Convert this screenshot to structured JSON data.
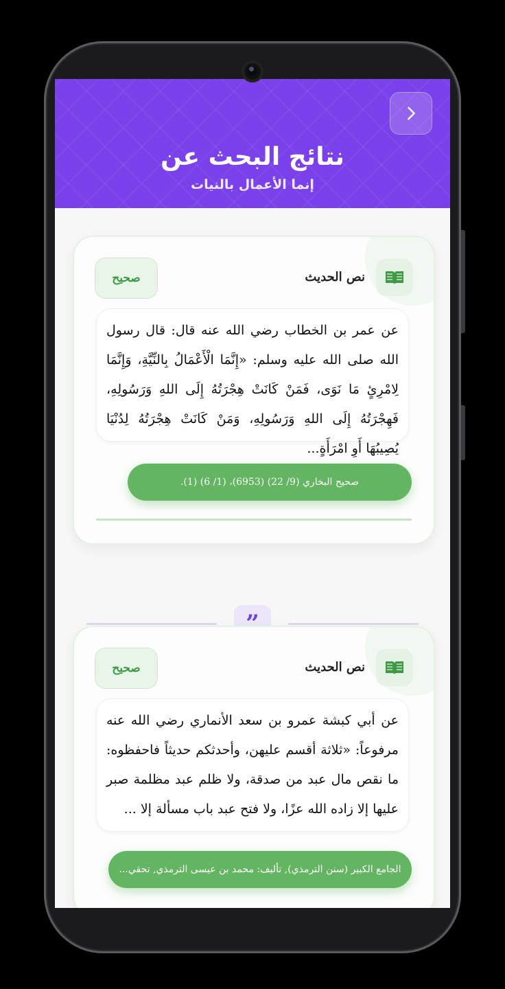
{
  "header": {
    "title": "نتائج البحث عن",
    "subtitle": "إنما الأعمال بالنيات",
    "back_icon": "chevron-right-icon",
    "bg_color": "#7a41ea"
  },
  "results": [
    {
      "label": "نص الحديث",
      "grade": "صحيح",
      "text": "عن عمر بن الخطاب رضي الله عنه قال: قال رسول الله صلى الله عليه وسلم: «إِنَّمَا الْأَعْمَالُ بِالنِّيَّةِ، وَإِنَّمَا لِامْرِئٍ مَا نَوَى، فَمَنْ كَانَتْ هِجْرَتُهُ إِلَى اللهِ وَرَسُولِهِ، فَهِجْرَتُهُ إِلَى اللهِ وَرَسُولِهِ، وَمَنْ كَانَتْ هِجْرَتُهُ لِدُنْيَا يُصِيبُهَا أَوِ امْرَأَةٍ...",
      "source": "صحيح البخاري (9/ 22) (6953)، (1/ 6) (1)."
    },
    {
      "label": "نص الحديث",
      "grade": "صحيح",
      "text": "عن أبي كبشة عمرو بن سعد الأنماري رضي الله عنه مرفوعاً: «ثلاثة أقسم عليهن، وأحدثكم حديثاً فاحفظوه: ما نقص مال عبد من صدقة، ولا ظلم عبد مظلمة صبر عليها إلا زاده الله عزًا، ولا فتح عبد باب مسألة إلا ...",
      "source": "الجامع الكبير (سنن الترمذي), تأليف: محمد بن عيسى الترمذي, تحقي..."
    }
  ],
  "separator_icon": "quote-icon",
  "colors": {
    "accent": "#7a41ea",
    "green": "#63b561",
    "badge_text": "#3f9a46"
  }
}
